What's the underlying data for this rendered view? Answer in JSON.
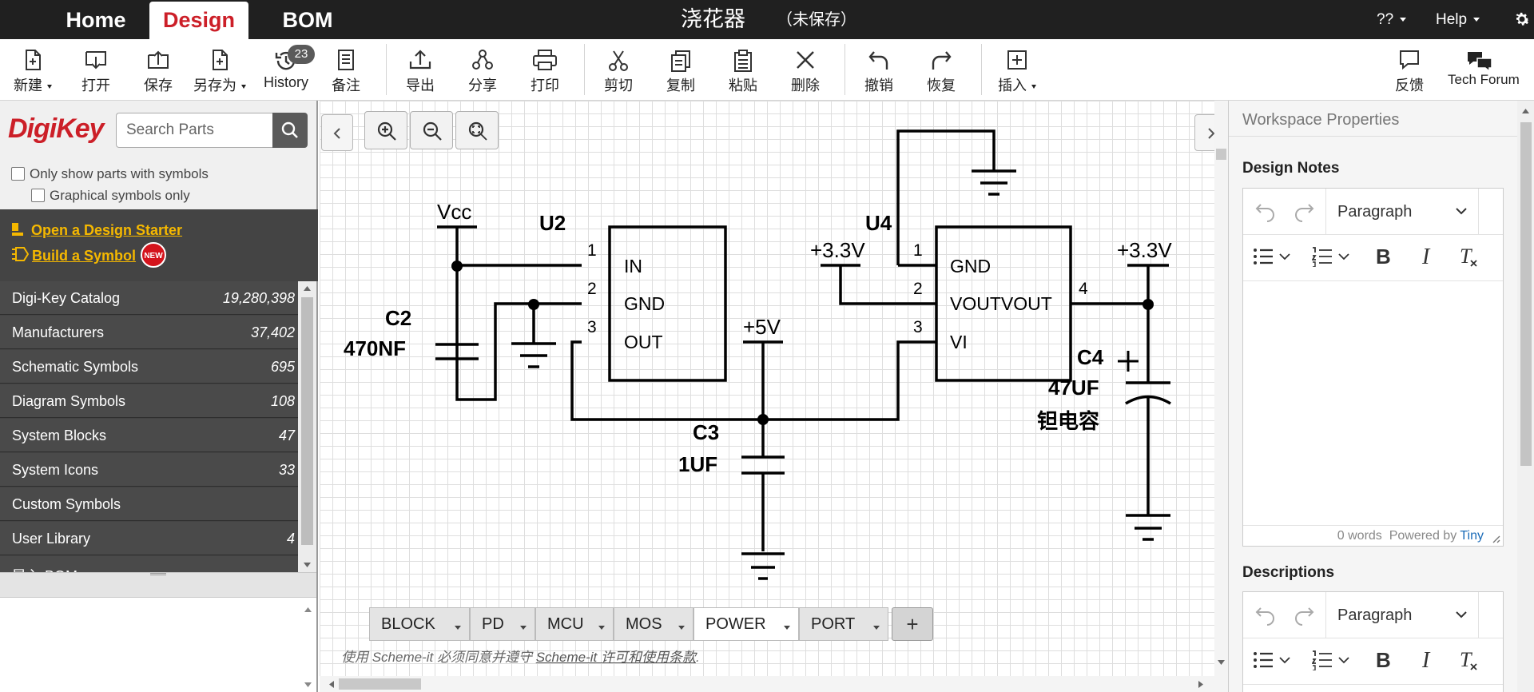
{
  "topbar": {
    "tabs": {
      "home": "Home",
      "design": "Design",
      "bom": "BOM"
    },
    "doc_title": "浇花器",
    "doc_status": "（未保存）",
    "menu_unknown": "??",
    "menu_help": "Help"
  },
  "toolbar": {
    "new": "新建",
    "open": "打开",
    "save": "保存",
    "save_as": "另存为",
    "history": "History",
    "history_count": "23",
    "notes": "备注",
    "export": "导出",
    "share": "分享",
    "print": "打印",
    "cut": "剪切",
    "copy": "复制",
    "paste": "粘贴",
    "delete": "删除",
    "undo": "撤销",
    "redo": "恢复",
    "insert": "插入",
    "feedback": "反馈",
    "tech_forum": "Tech Forum"
  },
  "left": {
    "logo": "DigiKey",
    "search_placeholder": "Search Parts",
    "only_symbols": "Only show parts with symbols",
    "graphical_only": "Graphical symbols only",
    "design_starter": "Open a Design Starter",
    "build_symbol": "Build a Symbol",
    "new_badge": "NEW",
    "categories": [
      {
        "name": "Digi-Key Catalog",
        "count": "19,280,398"
      },
      {
        "name": "Manufacturers",
        "count": "37,402"
      },
      {
        "name": "Schematic Symbols",
        "count": "695"
      },
      {
        "name": "Diagram Symbols",
        "count": "108"
      },
      {
        "name": "System Blocks",
        "count": "47"
      },
      {
        "name": "System Icons",
        "count": "33"
      },
      {
        "name": "Custom Symbols",
        "count": ""
      },
      {
        "name": "User Library",
        "count": "4"
      },
      {
        "name": "导入 BOM",
        "count": ""
      }
    ]
  },
  "schematic": {
    "vcc": "Vcc",
    "u2": "U2",
    "u2_pins": [
      "1",
      "2",
      "3"
    ],
    "u2_in": "IN",
    "u2_gnd": "GND",
    "u2_out": "OUT",
    "c2": "C2",
    "c2_val": "470NF",
    "p5v": "+5V",
    "c3": "C3",
    "c3_val": "1UF",
    "u4": "U4",
    "u4_pins": [
      "1",
      "2",
      "3",
      "4"
    ],
    "u4_gnd": "GND",
    "u4_vout": "VOUTVOUT",
    "u4_vi": "VI",
    "p33v_left": "+3.3V",
    "p33v_right": "+3.3V",
    "c4": "C4",
    "c4_val": "47UF",
    "c4_desc": "钽电容",
    "plus": "+"
  },
  "sheets": {
    "tabs": [
      "BLOCK",
      "PD",
      "MCU",
      "MOS",
      "POWER",
      "PORT"
    ],
    "active": "POWER",
    "add": "+"
  },
  "terms": {
    "prefix": "使用 Scheme-it 必须同意并遵守",
    "link": "Scheme-it 许可和使用条款",
    "suffix": "."
  },
  "right": {
    "title": "Workspace Properties",
    "design_notes": "Design Notes",
    "descriptions": "Descriptions",
    "paragraph": "Paragraph",
    "word_count": "0 words",
    "powered_by": "Powered by",
    "tiny": "Tiny"
  },
  "colors": {
    "brand_red": "#cc1f28",
    "link_yellow": "#f5b800",
    "topbar": "#202020"
  }
}
